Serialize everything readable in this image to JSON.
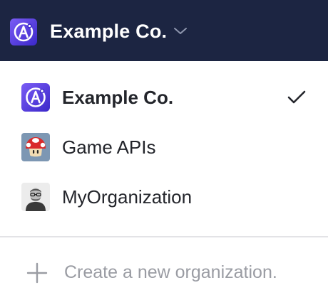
{
  "header": {
    "org_name": "Example Co.",
    "logo_icon": "org-logo-a-icon",
    "dropdown_icon": "chevron-down-icon"
  },
  "menu": {
    "items": [
      {
        "label": "Example Co.",
        "avatar": "org-logo-a-icon",
        "selected": true
      },
      {
        "label": "Game APIs",
        "avatar": "mushroom-avatar",
        "selected": false
      },
      {
        "label": "MyOrganization",
        "avatar": "user-photo-avatar",
        "selected": false
      }
    ],
    "create_label": "Create a new organization.",
    "create_icon": "plus-icon",
    "selected_icon": "checkmark-icon"
  },
  "colors": {
    "header_bg": "#1c2542",
    "logo_gradient_start": "#6b4ff0",
    "logo_gradient_end": "#3e2ad0",
    "muted_text": "#9a9ca3"
  }
}
